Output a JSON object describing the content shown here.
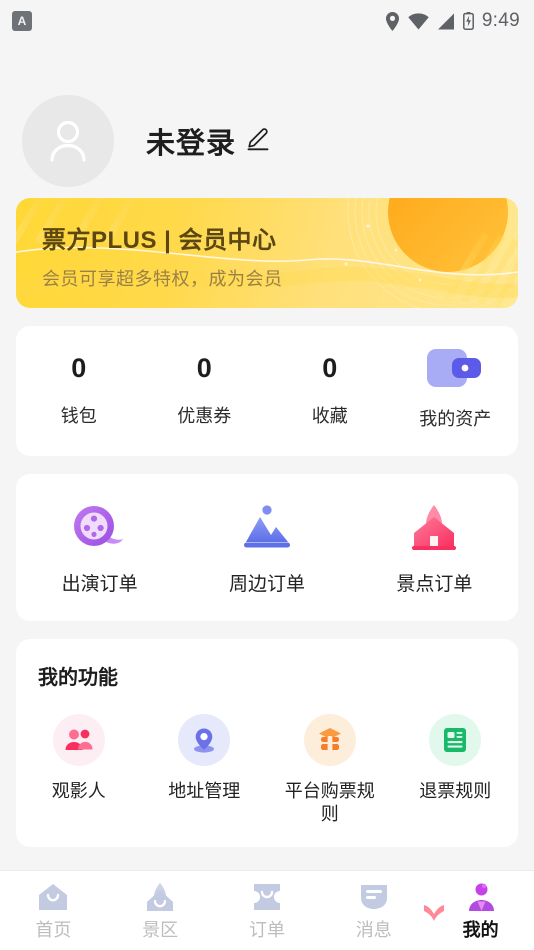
{
  "statusbar": {
    "app_badge": "A",
    "time": "9:49",
    "icons": [
      "location-pin-icon",
      "wifi-icon",
      "signal-icon",
      "battery-icon"
    ]
  },
  "profile": {
    "avatar_icon": "person-avatar-icon",
    "nickname": "未登录",
    "edit_icon": "edit-pencil-icon"
  },
  "plus_banner": {
    "title": "票方PLUS | 会员中心",
    "subtitle": "会员可享超多特权，成为会员",
    "title_color": "#5c4713",
    "subtitle_color": "#9b8046",
    "bg_start": "#ffd836",
    "bg_end": "#ffe890"
  },
  "stats": [
    {
      "value": "0",
      "label": "钱包",
      "icon": ""
    },
    {
      "value": "0",
      "label": "优惠券",
      "icon": ""
    },
    {
      "value": "0",
      "label": "收藏",
      "icon": ""
    },
    {
      "value": "",
      "label": "我的资产",
      "icon": "wallet-icon"
    }
  ],
  "orders": [
    {
      "label": "出演订单",
      "icon": "film-reel-icon",
      "color": "#a855e8"
    },
    {
      "label": "周边订单",
      "icon": "mountains-icon",
      "color": "#6b7ef0"
    },
    {
      "label": "景点订单",
      "icon": "temple-house-icon",
      "color": "#f8466f"
    }
  ],
  "functions": {
    "title": "我的功能",
    "items": [
      {
        "label": "观影人",
        "icon": "people-group-icon",
        "bg": "#fdeef3",
        "color": "#f8466f"
      },
      {
        "label": "地址管理",
        "icon": "location-pin-icon",
        "bg": "#e6e8fb",
        "color": "#6b72e8"
      },
      {
        "label": "平台购票规则",
        "icon": "ticket-stack-icon",
        "bg": "#fdeedb",
        "color": "#f77e28"
      },
      {
        "label": "退票规则",
        "icon": "document-list-icon",
        "bg": "#e2f8ec",
        "color": "#18b968"
      }
    ]
  },
  "tabbar": {
    "items": [
      {
        "label": "首页",
        "icon": "home-icon",
        "active": false
      },
      {
        "label": "景区",
        "icon": "scenic-mountain-icon",
        "active": false
      },
      {
        "label": "订单",
        "icon": "ticket-icon",
        "active": false
      },
      {
        "label": "消息",
        "icon": "message-badge-icon",
        "active": false
      },
      {
        "label": "我的",
        "icon": "user-profile-icon",
        "active": true
      }
    ],
    "decor_icon": "heart-icon",
    "active_color": "#141414",
    "inactive_color": "#bdbdbd"
  }
}
